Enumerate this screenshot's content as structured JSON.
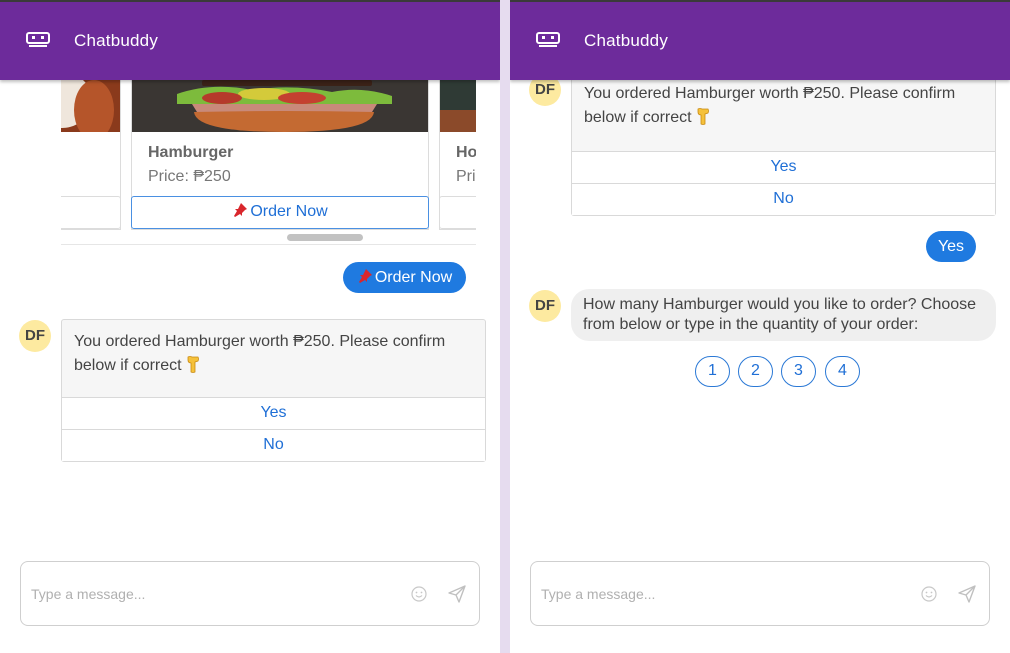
{
  "app": {
    "title": "Chatbuddy"
  },
  "left": {
    "carousel": {
      "cards": [
        {
          "name": "",
          "price": "",
          "button": ""
        },
        {
          "name": "Hamburger",
          "price": "Price: ₱250",
          "button": "Order Now"
        },
        {
          "name": "Ho",
          "price": "Pri",
          "button": ""
        }
      ]
    },
    "user_message": "Order Now",
    "bot": {
      "avatar": "DF",
      "message": "You ordered Hamburger worth ₱250. Please confirm below if correct",
      "options": [
        "Yes",
        "No"
      ]
    },
    "composer": {
      "placeholder": "Type a message..."
    }
  },
  "right": {
    "bot_confirm": {
      "avatar": "DF",
      "message": "You ordered Hamburger worth ₱250. Please confirm below if correct",
      "options": [
        "Yes",
        "No"
      ]
    },
    "user_message": "Yes",
    "bot_question": {
      "avatar": "DF",
      "message": "How many Hamburger would you like to order? Choose from below or type in the quantity of your order:"
    },
    "quantity_options": [
      "1",
      "2",
      "3",
      "4"
    ],
    "composer": {
      "placeholder": "Type a message..."
    }
  },
  "colors": {
    "header": "#6d2b9b",
    "accent": "#1f7ae0",
    "avatar_bg": "#fdeaa0"
  },
  "icons": {
    "logo": "robot-logo-icon",
    "order_pin": "pushpin-icon",
    "point_down": "pointing-down-hand-icon",
    "emoji": "smiley-icon",
    "send": "send-icon"
  }
}
